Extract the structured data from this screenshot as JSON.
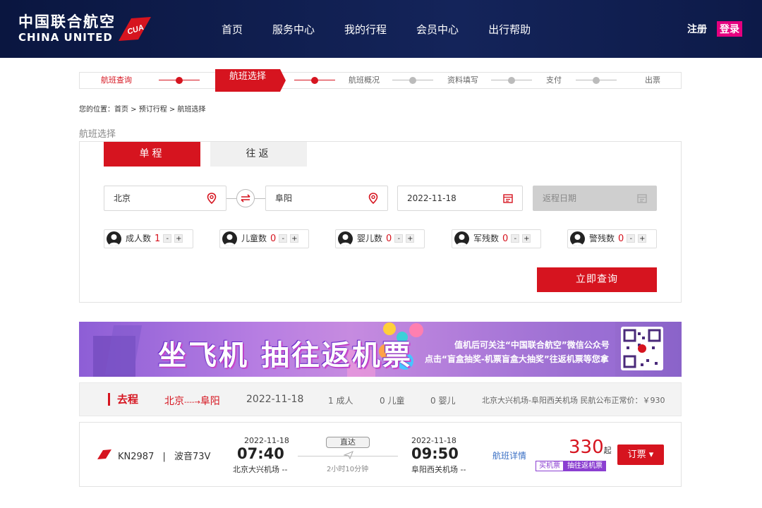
{
  "brand": {
    "name_cn": "中国联合航空",
    "name_en": "CHINA UNITED",
    "mark": "CUA"
  },
  "nav": [
    "首页",
    "服务中心",
    "我的行程",
    "会员中心",
    "出行帮助"
  ],
  "auth": {
    "register": "注册",
    "login": "登录"
  },
  "steps": [
    {
      "label": "航班查询",
      "state": "done"
    },
    {
      "label": "航班选择",
      "state": "current"
    },
    {
      "label": "航班概况",
      "state": "todo"
    },
    {
      "label": "资料填写",
      "state": "todo"
    },
    {
      "label": "支付",
      "state": "todo"
    },
    {
      "label": "出票",
      "state": "todo"
    }
  ],
  "breadcrumb": "您的位置：首页  >  预订行程  >  航班选择",
  "section_title": "航班选择",
  "search": {
    "tabs": {
      "one_way": "单程",
      "round_trip": "往返"
    },
    "from": "北京",
    "to": "阜阳",
    "depart_date": "2022-11-18",
    "return_placeholder": "返程日期",
    "passengers": [
      {
        "label": "成人数",
        "count": "1"
      },
      {
        "label": "儿童数",
        "count": "0"
      },
      {
        "label": "婴儿数",
        "count": "0"
      },
      {
        "label": "军残数",
        "count": "0"
      },
      {
        "label": "警残数",
        "count": "0"
      }
    ],
    "minus": "-",
    "plus": "+",
    "query_button": "立即查询"
  },
  "banner": {
    "headline": "坐飞机 抽往返机票",
    "line1": "值机后可关注“中国联合航空”微信公众号",
    "line2": "点击“盲盒抽奖-机票盲盒大抽奖”往返机票等您拿"
  },
  "route": {
    "label": "去程",
    "from": "北京",
    "to": "阜阳",
    "date": "2022-11-18",
    "adults": "1 成人",
    "children": "0 儿童",
    "infants": "0 婴儿",
    "fare_info": "北京大兴机场-阜阳西关机场 民航公布正常价：￥930"
  },
  "flight": {
    "number": "KN2987",
    "separator": "|",
    "aircraft": "波音73V",
    "dep_date": "2022-11-18",
    "dep_time": "07:40",
    "dep_airport": "北京大兴机场 --",
    "type": "直达",
    "duration": "2小时10分钟",
    "arr_date": "2022-11-18",
    "arr_time": "09:50",
    "arr_airport": "阜阳西关机场 --",
    "detail_link": "航班详情",
    "price": "330",
    "price_suffix": "起",
    "tag_buy": "买机票",
    "tag_draw": "抽往返机票",
    "book_button": "订票 ▾"
  },
  "colors": {
    "accent": "#d6141f",
    "header": "#0d1a48",
    "promo": "#8b3fd1",
    "login": "#e5007f"
  }
}
